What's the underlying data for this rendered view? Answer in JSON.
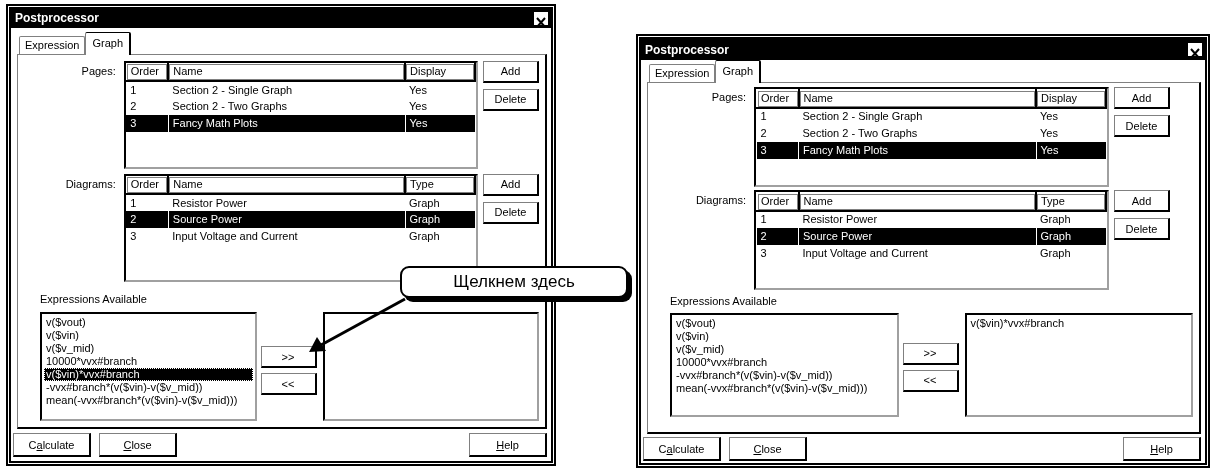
{
  "dialogs": [
    {
      "title": "Postprocessor",
      "tabs": [
        {
          "label": "Expression",
          "selected": false
        },
        {
          "label": "Graph",
          "selected": true
        }
      ],
      "pages": {
        "label": "Pages:",
        "columns": [
          "Order",
          "Name",
          "Display"
        ],
        "rows": [
          {
            "cells": [
              "1",
              "Section 2 - Single Graph",
              "Yes"
            ],
            "selected": false
          },
          {
            "cells": [
              "2",
              "Section 2 - Two Graphs",
              "Yes"
            ],
            "selected": false
          },
          {
            "cells": [
              "3",
              "Fancy Math Plots",
              "Yes"
            ],
            "selected": true
          }
        ],
        "buttons": [
          "Add",
          "Delete"
        ]
      },
      "diagrams": {
        "label": "Diagrams:",
        "columns": [
          "Order",
          "Name",
          "Type"
        ],
        "rows": [
          {
            "cells": [
              "1",
              "Resistor Power",
              "Graph"
            ],
            "selected": false
          },
          {
            "cells": [
              "2",
              "Source Power",
              "Graph"
            ],
            "selected": true
          },
          {
            "cells": [
              "3",
              "Input Voltage and Current",
              "Graph"
            ],
            "selected": false
          }
        ],
        "buttons": [
          "Add",
          "Delete"
        ]
      },
      "expressions": {
        "label": "Expressions Available",
        "available": [
          {
            "text": "v($vout)",
            "selected": false
          },
          {
            "text": "v($vin)",
            "selected": false
          },
          {
            "text": "v($v_mid)",
            "selected": false
          },
          {
            "text": "10000*vvx#branch",
            "selected": false
          },
          {
            "text": "v($vin)*vvx#branch",
            "selected": true
          },
          {
            "text": "-vvx#branch*(v($vin)-v($v_mid))",
            "selected": false
          },
          {
            "text": "mean(-vvx#branch*(v($vin)-v($v_mid)))",
            "selected": false
          }
        ],
        "move_buttons": [
          ">>",
          "<<"
        ]
      },
      "footer_left": [
        {
          "before": "C",
          "key": "a",
          "after": "lculate"
        },
        {
          "key": "C",
          "after": "lose"
        }
      ],
      "footer_right": [
        {
          "key": "H",
          "after": "elp"
        }
      ]
    },
    {
      "title": "Postprocessor",
      "tabs": [
        {
          "label": "Expression",
          "selected": false
        },
        {
          "label": "Graph",
          "selected": true
        }
      ],
      "pages": {
        "label": "Pages:",
        "columns": [
          "Order",
          "Name",
          "Display"
        ],
        "rows": [
          {
            "cells": [
              "1",
              "Section 2 - Single Graph",
              "Yes"
            ],
            "selected": false
          },
          {
            "cells": [
              "2",
              "Section 2 - Two Graphs",
              "Yes"
            ],
            "selected": false
          },
          {
            "cells": [
              "3",
              "Fancy Math Plots",
              "Yes"
            ],
            "selected": true
          }
        ],
        "buttons": [
          "Add",
          "Delete"
        ]
      },
      "diagrams": {
        "label": "Diagrams:",
        "columns": [
          "Order",
          "Name",
          "Type"
        ],
        "rows": [
          {
            "cells": [
              "1",
              "Resistor Power",
              "Graph"
            ],
            "selected": false
          },
          {
            "cells": [
              "2",
              "Source Power",
              "Graph"
            ],
            "selected": true
          },
          {
            "cells": [
              "3",
              "Input Voltage and Current",
              "Graph"
            ],
            "selected": false
          }
        ],
        "buttons": [
          "Add",
          "Delete"
        ]
      },
      "expressions": {
        "label": "Expressions Available",
        "available": [
          {
            "text": "v($vout)",
            "selected": false
          },
          {
            "text": "v($vin)",
            "selected": false
          },
          {
            "text": "v($v_mid)",
            "selected": false
          },
          {
            "text": "10000*vvx#branch",
            "selected": false
          },
          {
            "text": "-vvx#branch*(v($vin)-v($v_mid))",
            "selected": false
          },
          {
            "text": "mean(-vvx#branch*(v($vin)-v($v_mid)))",
            "selected": false
          }
        ],
        "move_buttons": [
          ">>",
          "<<"
        ],
        "chosen": [
          {
            "text": "v($vin)*vvx#branch"
          }
        ]
      },
      "footer_left": [
        {
          "before": "C",
          "key": "a",
          "after": "lculate"
        },
        {
          "key": "C",
          "after": "lose"
        }
      ],
      "footer_right": [
        {
          "key": "H",
          "after": "elp"
        }
      ]
    }
  ],
  "callout": {
    "text": "Щелкнем здесь"
  }
}
